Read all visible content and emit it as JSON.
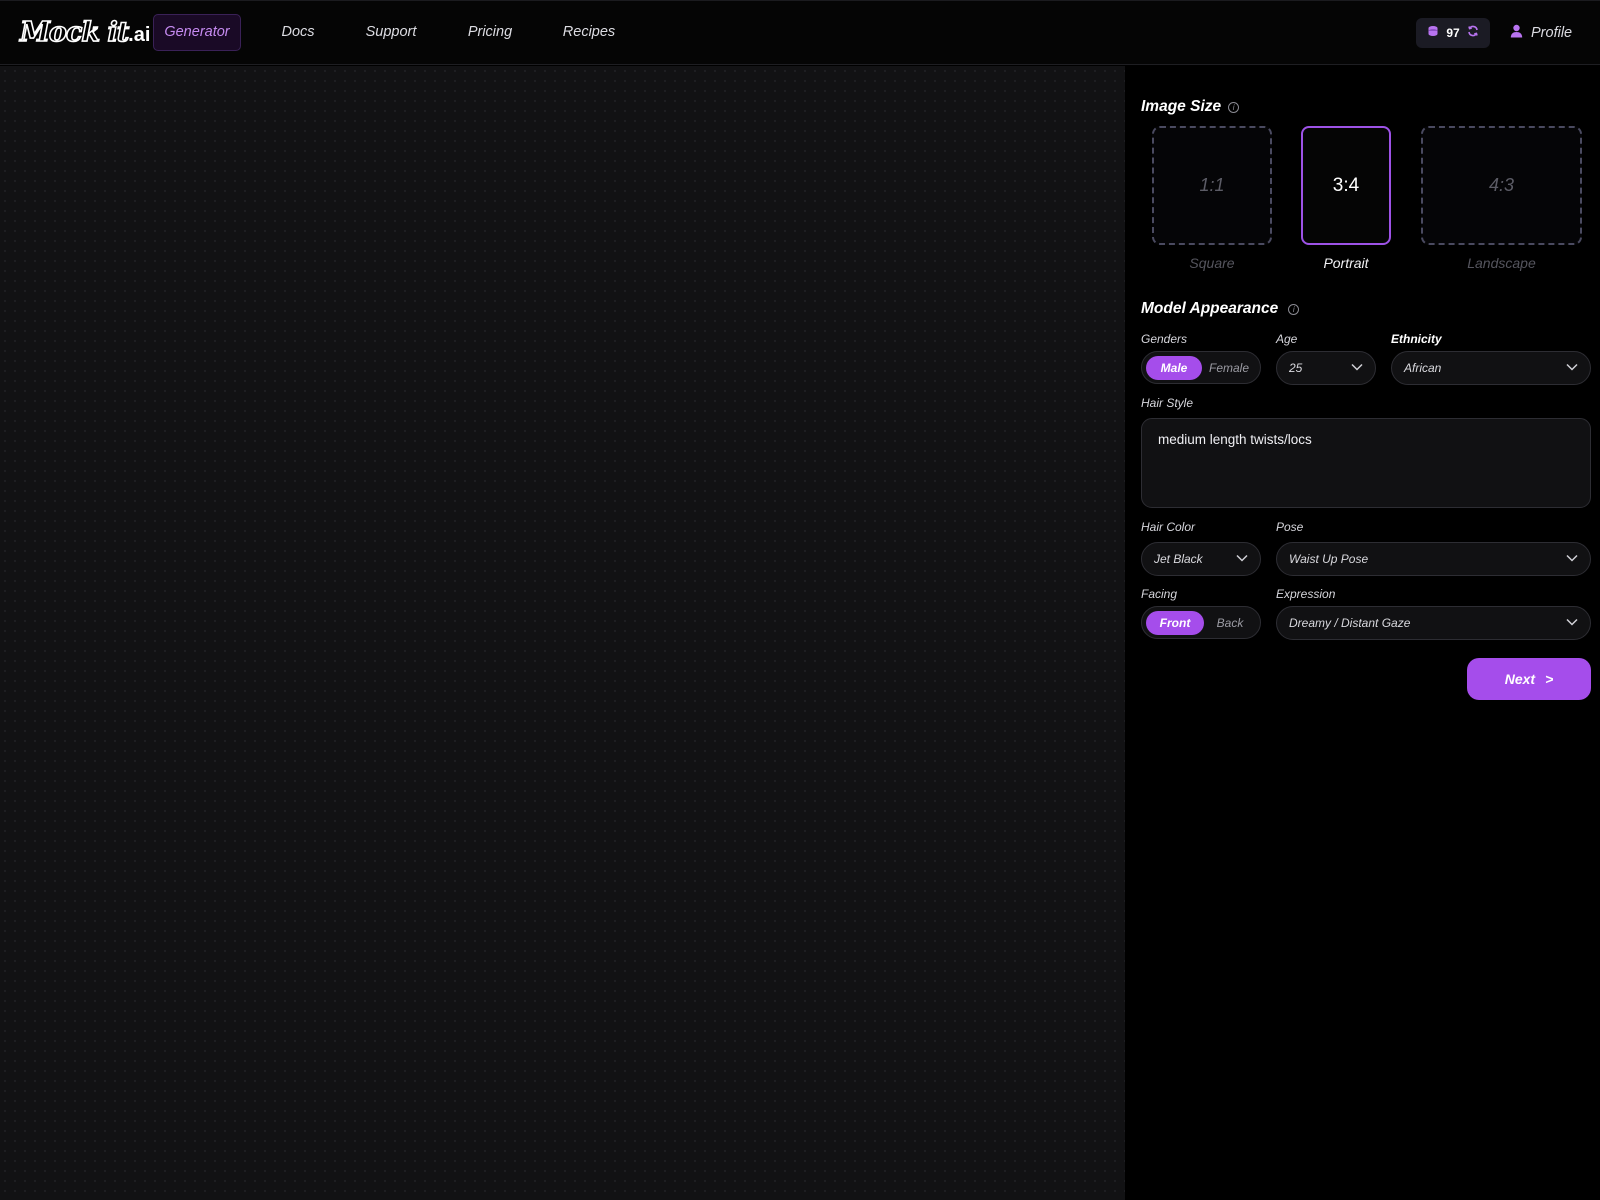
{
  "brand": {
    "script": "Mock it",
    "suffix": ".ai"
  },
  "nav": {
    "generator": "Generator",
    "docs": "Docs",
    "support": "Support",
    "pricing": "Pricing",
    "recipes": "Recipes"
  },
  "credits": {
    "count": "97",
    "icon": "coins-icon",
    "refresh_icon": "refresh-icon"
  },
  "profile": {
    "label": "Profile",
    "icon": "user-icon"
  },
  "image_size": {
    "title": "Image Size",
    "options": [
      {
        "ratio": "1:1",
        "label": "Square"
      },
      {
        "ratio": "3:4",
        "label": "Portrait"
      },
      {
        "ratio": "4:3",
        "label": "Landscape"
      }
    ],
    "selected": "3:4"
  },
  "appearance": {
    "title": "Model Appearance",
    "genders": {
      "label": "Genders",
      "options": [
        "Male",
        "Female"
      ],
      "selected": "Male"
    },
    "age": {
      "label": "Age",
      "value": "25"
    },
    "ethnicity": {
      "label": "Ethnicity",
      "value": "African"
    },
    "hair_style": {
      "label": "Hair Style",
      "value": "medium length twists/locs"
    },
    "hair_color": {
      "label": "Hair Color",
      "value": "Jet Black"
    },
    "pose": {
      "label": "Pose",
      "value": "Waist Up Pose"
    },
    "facing": {
      "label": "Facing",
      "options": [
        "Front",
        "Back"
      ],
      "selected": "Front"
    },
    "expression": {
      "label": "Expression",
      "value": "Dreamy / Distant Gaze"
    }
  },
  "next_button": {
    "label": "Next",
    "arrow": ">"
  },
  "colors": {
    "accent": "#a54deb",
    "accent_text": "#c58af0",
    "background": "#000000",
    "canvas": "#121214"
  }
}
